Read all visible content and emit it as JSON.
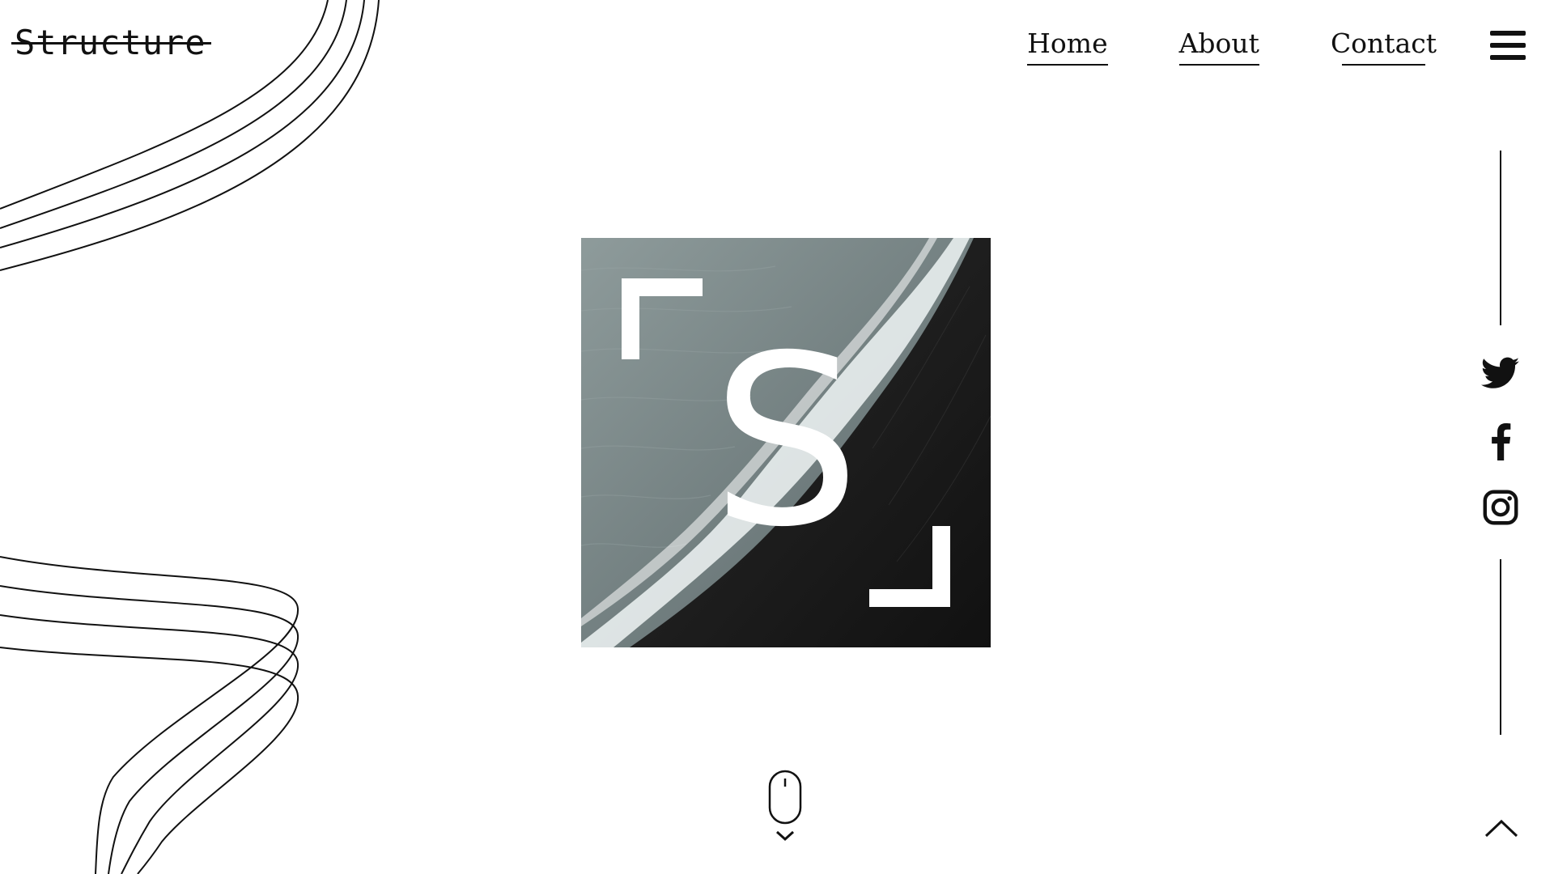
{
  "site": {
    "logo_text": "Structure"
  },
  "nav": {
    "items": [
      {
        "label": "Home"
      },
      {
        "label": "About"
      },
      {
        "label": "Contact"
      }
    ]
  },
  "hero": {
    "letter": "S"
  },
  "social": {
    "items": [
      {
        "icon": "twitter-icon"
      },
      {
        "icon": "facebook-icon"
      },
      {
        "icon": "instagram-icon"
      }
    ]
  },
  "colors": {
    "ink": "#111111",
    "background": "#ffffff",
    "hero_letter": "#ffffff"
  }
}
